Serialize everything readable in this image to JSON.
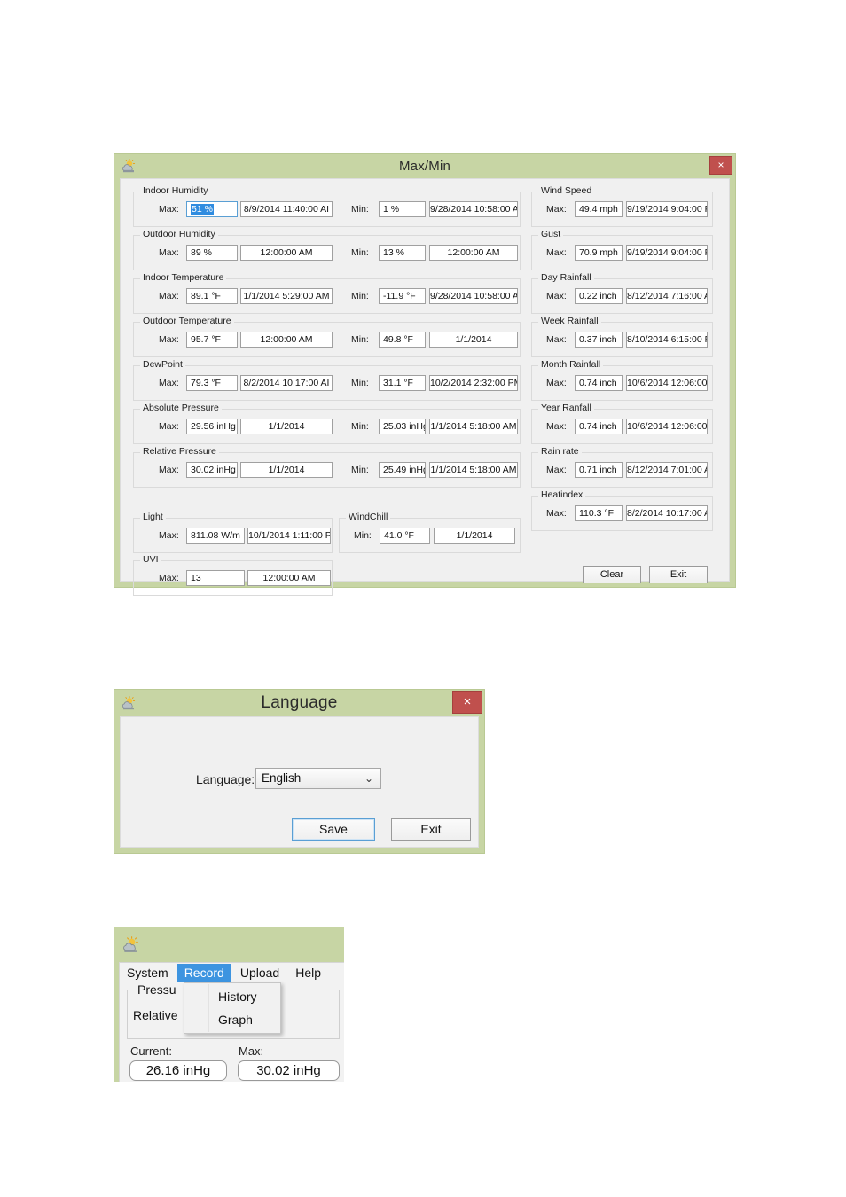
{
  "maxmin": {
    "title": "Max/Min",
    "icon": "weather-app-icon",
    "close_label": "×",
    "max_label": "Max:",
    "min_label": "Min:",
    "clear_label": "Clear",
    "exit_label": "Exit",
    "left_groups": [
      {
        "name": "Indoor Humidity",
        "max_value": "51 %",
        "max_value_selected": true,
        "max_date": "8/9/2014 11:40:00 AI",
        "min_value": "1 %",
        "min_date": "9/28/2014 10:58:00 AN"
      },
      {
        "name": "Outdoor Humidity",
        "max_value": "89 %",
        "max_date": "12:00:00 AM",
        "min_value": "13 %",
        "min_date": "12:00:00 AM"
      },
      {
        "name": "Indoor Temperature",
        "max_value": "89.1 °F",
        "max_date": "1/1/2014 5:29:00 AM",
        "min_value": "-11.9 °F",
        "min_date": "9/28/2014 10:58:00 AN"
      },
      {
        "name": "Outdoor Temperature",
        "max_value": "95.7 °F",
        "max_date": "12:00:00 AM",
        "min_value": "49.8 °F",
        "min_date": "1/1/2014"
      },
      {
        "name": "DewPoint",
        "max_value": "79.3 °F",
        "max_date": "8/2/2014 10:17:00 AI",
        "min_value": "31.1 °F",
        "min_date": "10/2/2014 2:32:00 PM"
      },
      {
        "name": "Absolute Pressure",
        "max_value": "29.56 inHg",
        "max_date": "1/1/2014",
        "min_value": "25.03 inHg",
        "min_date": "1/1/2014 5:18:00 AM"
      },
      {
        "name": "Relative Pressure",
        "max_value": "30.02 inHg",
        "max_date": "1/1/2014",
        "min_value": "25.49 inHg",
        "min_date": "1/1/2014 5:18:00 AM"
      }
    ],
    "light_group": {
      "name": "Light",
      "max_value": "811.08 W/m",
      "max_date": "10/1/2014 1:11:00 Pf"
    },
    "uvi_group": {
      "name": "UVI",
      "max_value": "13",
      "max_date": "12:00:00 AM"
    },
    "windchill_group": {
      "name": "WindChill",
      "min_value": "41.0 °F",
      "min_date": "1/1/2014"
    },
    "right_groups": [
      {
        "name": "Wind Speed",
        "max_value": "49.4 mph",
        "max_date": "9/19/2014 9:04:00 PИ"
      },
      {
        "name": "Gust",
        "max_value": "70.9 mph",
        "max_date": "9/19/2014 9:04:00 PИ"
      },
      {
        "name": "Day Rainfall",
        "max_value": "0.22 inch",
        "max_date": "8/12/2014 7:16:00 A"
      },
      {
        "name": "Week Rainfall",
        "max_value": "0.37 inch",
        "max_date": "8/10/2014 6:15:00 P"
      },
      {
        "name": "Month Rainfall",
        "max_value": "0.74 inch",
        "max_date": "10/6/2014 12:06:00"
      },
      {
        "name": "Year Ranfall",
        "max_value": "0.74 inch",
        "max_date": "10/6/2014 12:06:00"
      },
      {
        "name": "Rain rate",
        "max_value": "0.71 inch",
        "max_date": "8/12/2014 7:01:00 A"
      },
      {
        "name": "Heatindex",
        "max_value": "110.3 °F",
        "max_date": "8/2/2014 10:17:00 A"
      }
    ]
  },
  "language_dialog": {
    "title": "Language",
    "icon": "weather-app-icon",
    "close_label": "×",
    "field_label": "Language:",
    "selected_language": "English",
    "chevron": "⌄",
    "save_label": "Save",
    "exit_label": "Exit"
  },
  "menu_panel": {
    "icon": "weather-app-icon",
    "menubar": [
      {
        "label": "System",
        "active": false
      },
      {
        "label": "Record",
        "active": true
      },
      {
        "label": "Upload",
        "active": false
      },
      {
        "label": "Help",
        "active": false
      }
    ],
    "dropdown_items": [
      {
        "label": "History"
      },
      {
        "label": "Graph"
      }
    ],
    "group_label": "Pressu",
    "row_label": "Relative",
    "current_caption": "Current:",
    "max_caption": "Max:",
    "current_value": "26.16 inHg",
    "max_value": "30.02 inHg"
  },
  "colors": {
    "window_chrome": "#c7d5a4",
    "close_button": "#c0504d",
    "client_bg": "#f0f0f0",
    "selection_blue": "#2f8ce0",
    "menu_highlight": "#3d94e0"
  }
}
